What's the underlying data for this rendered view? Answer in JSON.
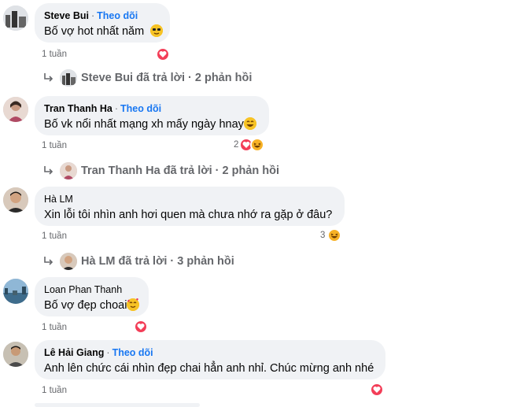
{
  "comments": [
    {
      "author": "Steve Bui",
      "follow": "Theo dõi",
      "text": "Bố vợ hot nhất năm",
      "text_emoji": "sunglasses-emoji",
      "time": "1 tuần",
      "reactions": {
        "count": "",
        "types": [
          "heart"
        ]
      },
      "reply": {
        "label": "Steve Bui đã trả lời · 2 phản hồi"
      }
    },
    {
      "author": "Tran Thanh Ha",
      "follow": "Theo dõi",
      "text": "Bố vk nổi nhất mạng xh mấy ngày hnay",
      "text_emoji": "grin-emoji",
      "time": "1 tuần",
      "reactions": {
        "count": "2",
        "types": [
          "heart",
          "haha"
        ]
      },
      "reply": {
        "label": "Tran Thanh Ha đã trả lời · 2 phản hồi"
      }
    },
    {
      "author": "Hà LM",
      "follow": "",
      "text": "Xin lỗi tôi nhìn anh hơi quen mà chưa nhớ ra gặp ở đâu?",
      "text_emoji": "",
      "time": "1 tuần",
      "reactions": {
        "count": "3",
        "types": [
          "haha"
        ]
      },
      "reply": {
        "label": "Hà LM đã trả lời · 3 phản hồi"
      }
    },
    {
      "author": "Loan Phan Thanh",
      "follow": "",
      "text": "Bố vợ đẹp choai",
      "text_emoji": "hearts-face-emoji",
      "time": "1 tuần",
      "reactions": {
        "count": "",
        "types": [
          "heart"
        ]
      }
    },
    {
      "author": "Lê Hải Giang",
      "follow": "Theo dõi",
      "text": "Anh lên chức cái nhìn đẹp chai hẳn anh nhỉ. Chúc mừng anh nhé",
      "text_emoji": "",
      "time": "1 tuần",
      "reactions": {
        "count": "",
        "types": [
          "heart"
        ]
      }
    }
  ],
  "colors": {
    "bubble": "#f0f2f5",
    "follow": "#1877f2",
    "heart": "#f33e58",
    "haha": "#f7b125",
    "meta": "#65676b"
  }
}
